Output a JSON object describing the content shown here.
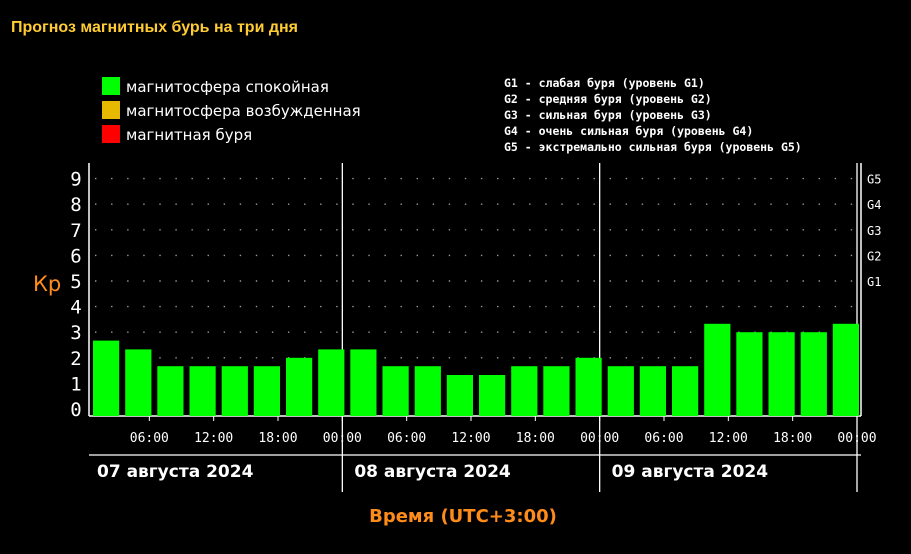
{
  "page": {
    "title": "Прогноз магнитных бурь на три дня"
  },
  "legend": [
    {
      "label": "магнитосфера спокойная",
      "color": "#00ff00"
    },
    {
      "label": "магнитосфера возбужденная",
      "color": "#e6b800"
    },
    {
      "label": "магнитная буря",
      "color": "#ff0000"
    }
  ],
  "storm_levels": [
    "G1 - слабая буря (уровень G1)",
    "G2 - средняя буря (уровень G2)",
    "G3 - сильная буря (уровень G3)",
    "G4 - очень сильная буря (уровень G4)",
    "G5 - экстремально сильная буря (уровень G5)"
  ],
  "chart_data": {
    "type": "bar",
    "ylabel": "Кр",
    "xlabel": "Время (UTC+3:00)",
    "ylim": [
      0,
      9
    ],
    "yticks": [
      "0",
      "1",
      "2",
      "3",
      "4",
      "5",
      "6",
      "7",
      "8",
      "9"
    ],
    "right_ticks": [
      {
        "label": "G1",
        "value": 5
      },
      {
        "label": "G2",
        "value": 6
      },
      {
        "label": "G3",
        "value": 7
      },
      {
        "label": "G4",
        "value": 8
      },
      {
        "label": "G5",
        "value": 9
      }
    ],
    "grid": "dotted",
    "days": [
      "07 августа 2024",
      "08 августа 2024",
      "09 августа 2024"
    ],
    "xtick_labels": [
      "06:00",
      "12:00",
      "18:00",
      "00:00",
      "06:00",
      "12:00",
      "18:00",
      "00:00",
      "06:00",
      "12:00",
      "18:00",
      "00:00"
    ],
    "bar_color": "#00ff00",
    "values": [
      2.67,
      2.33,
      1.67,
      1.67,
      1.67,
      1.67,
      2.0,
      2.33,
      2.33,
      1.67,
      1.67,
      1.33,
      1.33,
      1.67,
      1.67,
      2.0,
      1.67,
      1.67,
      1.67,
      3.33,
      3.0,
      3.0,
      3.0,
      3.33
    ]
  }
}
